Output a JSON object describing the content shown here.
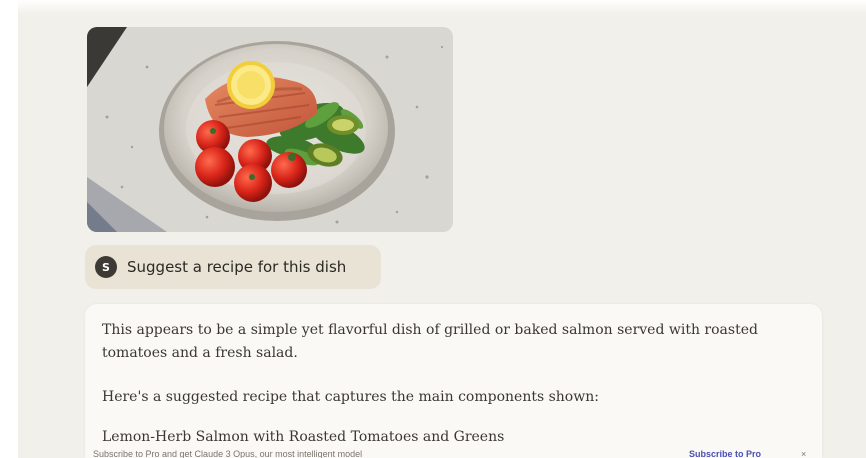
{
  "message": {
    "image_alt": "Plate of grilled salmon with lemon, roasted tomatoes and greens",
    "prompt_avatar": "S",
    "prompt_text": "Suggest a recipe for this dish"
  },
  "response": {
    "paragraph1": "This appears to be a simple yet flavorful dish of grilled or baked salmon served with roasted tomatoes and a fresh salad.",
    "paragraph2": "Here's a suggested recipe that captures the main components shown:",
    "paragraph3": "Lemon-Herb Salmon with Roasted Tomatoes and Greens"
  },
  "footer": {
    "text": "Subscribe to Pro and get Claude 3 Opus, our most intelligent model",
    "link": "Subscribe to Pro",
    "close": "×"
  },
  "colors": {
    "background": "#f2f0ea",
    "prompt_chip": "#e9e3d6",
    "response_card": "#fbf9f6",
    "link": "#4a4fb5"
  }
}
